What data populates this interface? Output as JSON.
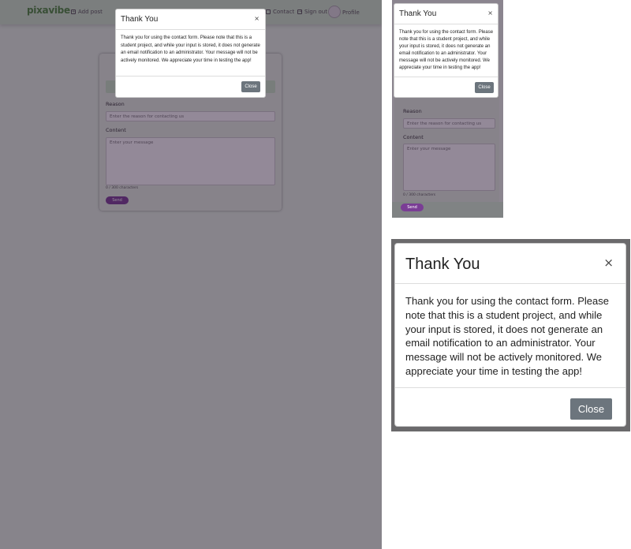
{
  "navbar": {
    "logo_text": "pixavibe",
    "add_post": "Add post",
    "contact": "Contact",
    "sign_out": "Sign out",
    "profile": "Profile"
  },
  "form": {
    "reason_label": "Reason",
    "reason_placeholder": "Enter the reason for contacting us",
    "content_label": "Content",
    "content_placeholder": "Enter your message",
    "counter": "0 / 300 characters",
    "send_label": "Send"
  },
  "modal": {
    "title": "Thank You",
    "close_x": "×",
    "body": "Thank you for using the contact form. Please note that this is a student project, and while your input is stored, it does not generate an email notification to an administrator. Your message will not be actively monitored. We appreciate your time in testing the app!",
    "close_button": "Close"
  },
  "colors": {
    "backdrop": "#6a5a72",
    "send_button": "#7a3d95",
    "close_button": "#6c757d",
    "card_background": "#e6f3e2"
  }
}
